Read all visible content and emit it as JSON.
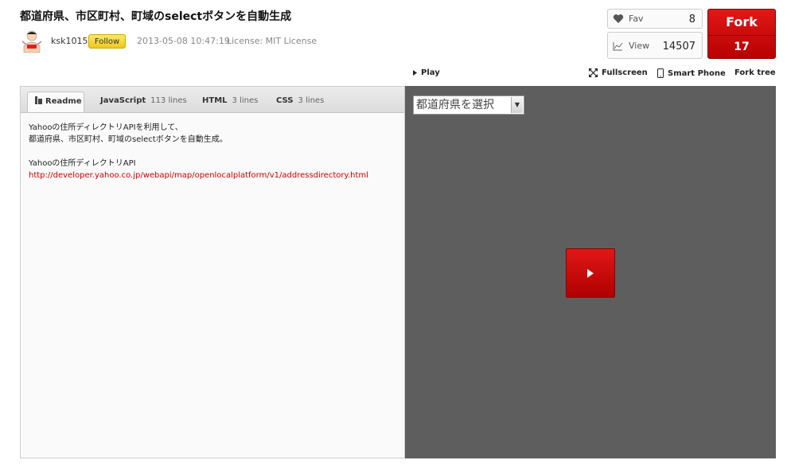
{
  "page": {
    "title": "都道府県、市区町村、町域のselectボタンを自動生成"
  },
  "author": {
    "username": "ksk1015",
    "follow_label": "Follow",
    "date": "2013-05-08 10:47:19",
    "license": "License: MIT License"
  },
  "stats": {
    "fav_label": "Fav",
    "fav_count": "8",
    "view_label": "View",
    "view_count": "14507",
    "fork_label": "Fork",
    "fork_count": "17"
  },
  "toolbar": {
    "play": "Play",
    "fullscreen": "Fullscreen",
    "smartphone": "Smart Phone",
    "fork_tree": "Fork tree"
  },
  "tabs": [
    {
      "label": "Readme",
      "lines": ""
    },
    {
      "label": "JavaScript",
      "lines": "113 lines"
    },
    {
      "label": "HTML",
      "lines": "3 lines"
    },
    {
      "label": "CSS",
      "lines": "3 lines"
    }
  ],
  "readme": {
    "line1": "Yahooの住所ディレクトリAPIを利用して、",
    "line2": "都道府県、市区町村、町域のselectボタンを自動生成。",
    "line3": "Yahooの住所ディレクトリAPI",
    "link": "http://developer.yahoo.co.jp/webapi/map/openlocalplatform/v1/addressdirectory.html"
  },
  "preview": {
    "select_value": "都道府県を選択"
  },
  "icons": {
    "fav": "heart-icon",
    "view": "chart-line-icon",
    "play": "play-triangle-icon",
    "fullscreen": "fullscreen-icon",
    "smartphone": "smartphone-icon",
    "readme": "document-icon",
    "select": "dropdown-arrow-icon",
    "big_play": "play-icon"
  },
  "colors": {
    "fork_red": "#c80000",
    "follow_yellow": "#f5d630",
    "link_red": "#cc0000",
    "preview_bg": "#5e5e5e"
  }
}
